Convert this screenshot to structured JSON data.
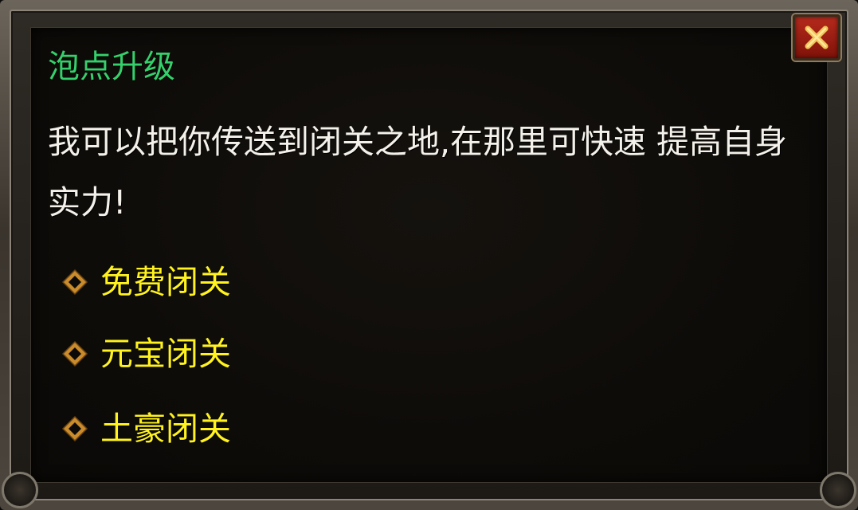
{
  "dialog": {
    "title": "泡点升级",
    "description": "我可以把你传送到闭关之地,在那里可快速 提高自身实力!",
    "close_icon": "close-x-icon",
    "colors": {
      "title": "#35d06b",
      "description": "#f4f1ea",
      "option": "#fff21f",
      "close_button": "#b62a1c"
    },
    "options": [
      {
        "label": "免费闭关",
        "icon": "diamond-bullet-icon"
      },
      {
        "label": "元宝闭关",
        "icon": "diamond-bullet-icon"
      },
      {
        "label": "土豪闭关",
        "icon": "diamond-bullet-icon"
      }
    ]
  }
}
